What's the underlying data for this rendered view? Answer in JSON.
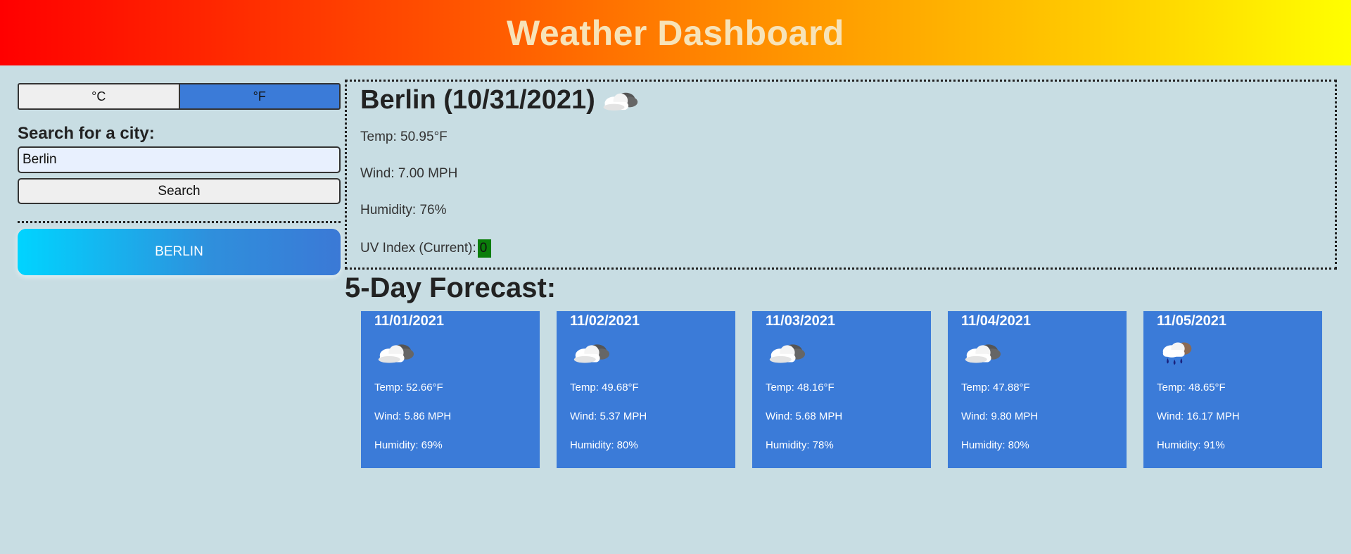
{
  "header": {
    "title": "Weather Dashboard"
  },
  "sidebar": {
    "unit_celsius": "°C",
    "unit_fahrenheit": "°F",
    "search_label": "Search for a city:",
    "search_value": "Berlin",
    "search_button": "Search",
    "history": [
      "BERLIN"
    ]
  },
  "current": {
    "title": "Berlin (10/31/2021)",
    "icon": "cloudy-icon",
    "temp": "Temp: 50.95°F",
    "wind": "Wind: 7.00 MPH",
    "humidity": "Humidity: 76%",
    "uv_label": "UV Index (Current):",
    "uv_value": "0",
    "uv_color": "#0a7d0a"
  },
  "forecast": {
    "title": "5-Day Forecast:",
    "days": [
      {
        "date": "11/01/2021",
        "icon": "cloudy-icon",
        "temp": "Temp: 52.66°F",
        "wind": "Wind: 5.86 MPH",
        "humidity": "Humidity: 69%"
      },
      {
        "date": "11/02/2021",
        "icon": "cloudy-icon",
        "temp": "Temp: 49.68°F",
        "wind": "Wind: 5.37 MPH",
        "humidity": "Humidity: 80%"
      },
      {
        "date": "11/03/2021",
        "icon": "cloudy-icon",
        "temp": "Temp: 48.16°F",
        "wind": "Wind: 5.68 MPH",
        "humidity": "Humidity: 78%"
      },
      {
        "date": "11/04/2021",
        "icon": "cloudy-icon",
        "temp": "Temp: 47.88°F",
        "wind": "Wind: 9.80 MPH",
        "humidity": "Humidity: 80%"
      },
      {
        "date": "11/05/2021",
        "icon": "rain-icon",
        "temp": "Temp: 48.65°F",
        "wind": "Wind: 16.17 MPH",
        "humidity": "Humidity: 91%"
      }
    ]
  },
  "colors": {
    "background": "#c8dde3",
    "accent": "#3b7bd8",
    "header_text": "#f7e3b8"
  }
}
